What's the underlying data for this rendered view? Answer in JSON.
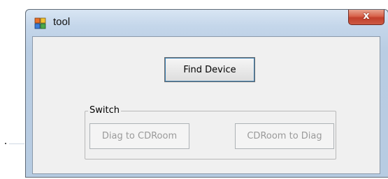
{
  "window": {
    "title": "tool",
    "close_glyph": "x",
    "app_icon": "application-icon"
  },
  "main": {
    "find_device_label": "Find Device"
  },
  "switch_group": {
    "label": "Switch",
    "diag_to_cdroom_label": "Diag to CDRoom",
    "cdroom_to_diag_label": "CDRoom to Diag",
    "buttons_enabled": false
  },
  "colors": {
    "close_button": "#c9452f",
    "client_background": "#f0f0f0",
    "disabled_text": "#9a9a9a"
  }
}
